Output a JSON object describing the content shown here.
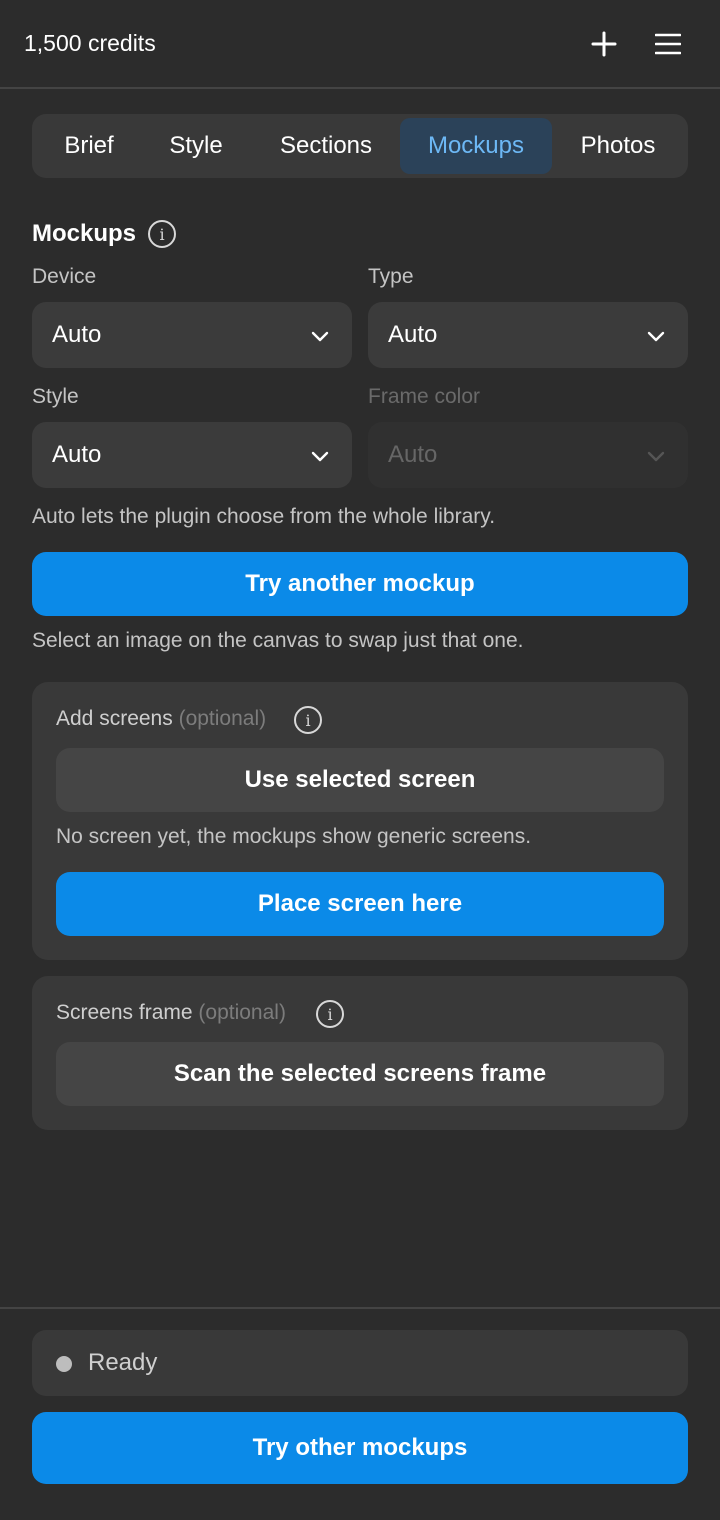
{
  "header": {
    "credits": "1,500 credits",
    "add_icon": "plus-icon",
    "menu_icon": "hamburger-menu-icon"
  },
  "tabs": [
    {
      "label": "Brief",
      "active": false
    },
    {
      "label": "Style",
      "active": false
    },
    {
      "label": "Sections",
      "active": false
    },
    {
      "label": "Mockups",
      "active": true
    },
    {
      "label": "Photos",
      "active": false
    }
  ],
  "mockups": {
    "title": "Mockups",
    "device": {
      "label": "Device",
      "value": "Auto"
    },
    "type": {
      "label": "Type",
      "value": "Auto"
    },
    "style": {
      "label": "Style",
      "value": "Auto"
    },
    "frame_color": {
      "label": "Frame color",
      "value": "Auto",
      "disabled": true
    },
    "auto_helper": "Auto lets the plugin choose from the whole library.",
    "try_another_button": "Try another mockup",
    "swap_helper": "Select an image on the canvas to swap just that one."
  },
  "add_screens": {
    "label": "Add screens",
    "optional": "(optional)",
    "use_selected_button": "Use selected screen",
    "helper": "No screen yet, the mockups show generic screens.",
    "place_button": "Place screen here"
  },
  "screens_frame": {
    "label": "Screens frame",
    "optional": "(optional)",
    "scan_button": "Scan the selected screens frame"
  },
  "footer": {
    "status": "Ready",
    "try_other_button": "Try other mockups"
  },
  "colors": {
    "background": "#2c2c2c",
    "accent": "#0b8ae8",
    "active_tab_text": "#6db8f5",
    "active_tab_bg": "#2b4259"
  }
}
